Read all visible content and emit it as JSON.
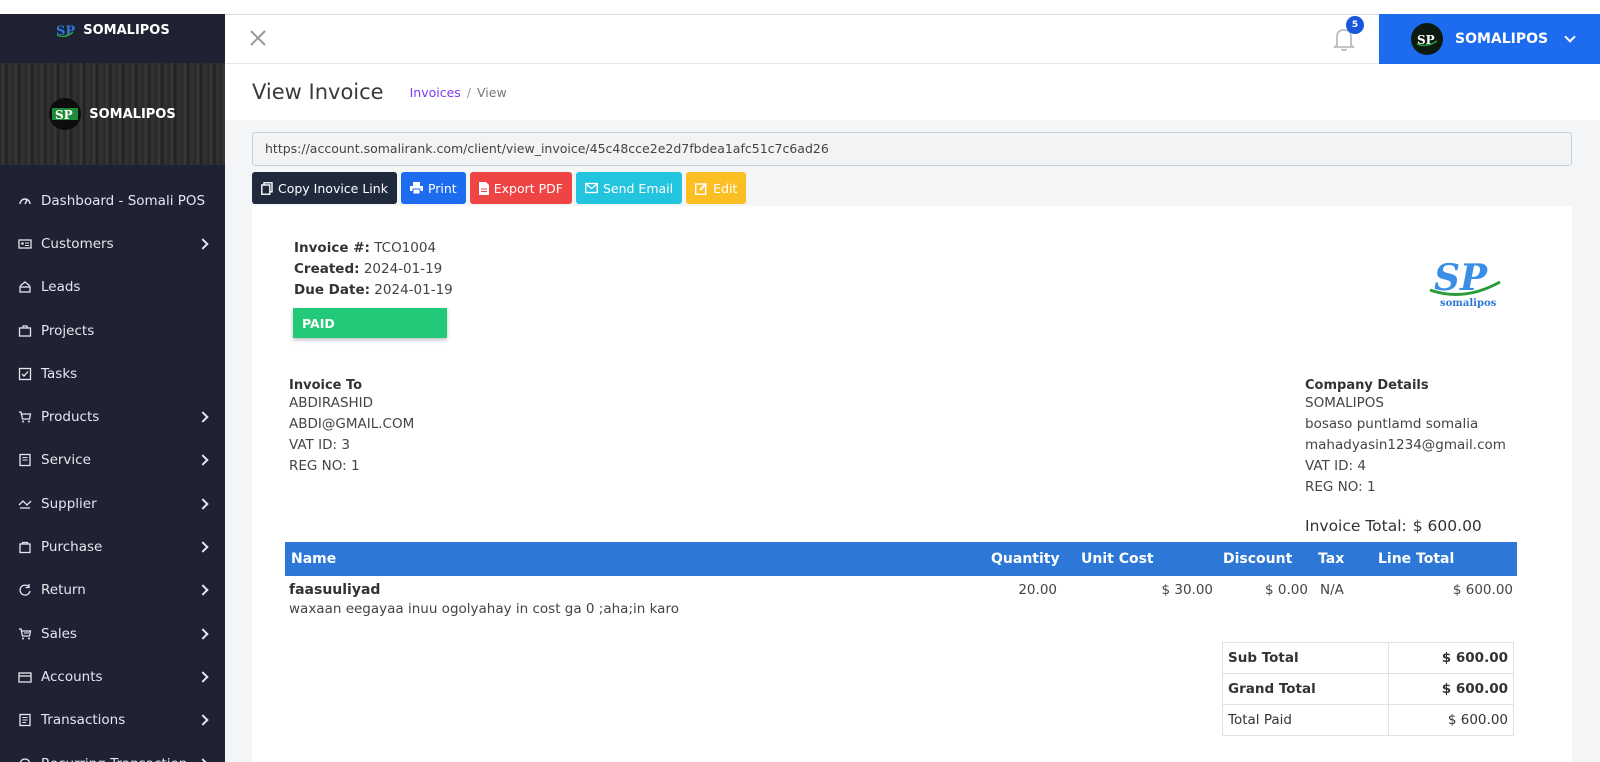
{
  "brand": {
    "name": "SOMALIPOS",
    "logo_text": "SP",
    "logo_subtext": "somalipos"
  },
  "sidebar": {
    "items": [
      {
        "label": "Dashboard - Somali POS",
        "icon": "dashboard-icon",
        "has_submenu": false
      },
      {
        "label": "Customers",
        "icon": "customers-icon",
        "has_submenu": true
      },
      {
        "label": "Leads",
        "icon": "leads-icon",
        "has_submenu": false
      },
      {
        "label": "Projects",
        "icon": "projects-icon",
        "has_submenu": false
      },
      {
        "label": "Tasks",
        "icon": "tasks-icon",
        "has_submenu": false
      },
      {
        "label": "Products",
        "icon": "products-icon",
        "has_submenu": true
      },
      {
        "label": "Service",
        "icon": "service-icon",
        "has_submenu": true
      },
      {
        "label": "Supplier",
        "icon": "supplier-icon",
        "has_submenu": true
      },
      {
        "label": "Purchase",
        "icon": "purchase-icon",
        "has_submenu": true
      },
      {
        "label": "Return",
        "icon": "return-icon",
        "has_submenu": true
      },
      {
        "label": "Sales",
        "icon": "sales-icon",
        "has_submenu": true
      },
      {
        "label": "Accounts",
        "icon": "accounts-icon",
        "has_submenu": true
      },
      {
        "label": "Transactions",
        "icon": "transactions-icon",
        "has_submenu": true
      },
      {
        "label": "Recurring Transaction",
        "icon": "recurring-icon",
        "has_submenu": true
      }
    ]
  },
  "topbar": {
    "notification_count": "5",
    "user_name": "SOMALIPOS"
  },
  "page": {
    "title": "View Invoice",
    "breadcrumb": {
      "parent": "Invoices",
      "current": "View"
    },
    "invoice_url": "https://account.somalirank.com/client/view_invoice/45c48cce2e2d7fbdea1afc51c7c6ad26"
  },
  "actions": {
    "copy_link": "Copy Inovice Link",
    "print": "Print",
    "export_pdf": "Export PDF",
    "send_email": "Send Email",
    "edit": "Edit"
  },
  "invoice": {
    "number_label": "Invoice #:",
    "number": "TCO1004",
    "created_label": "Created:",
    "created": "2024-01-19",
    "due_label": "Due Date:",
    "due": "2024-01-19",
    "status": "PAID",
    "to": {
      "heading": "Invoice To",
      "name": "ABDIRASHID",
      "email": "ABDI@GMAIL.COM",
      "vat": "VAT ID: 3",
      "reg": "REG NO: 1"
    },
    "company": {
      "heading": "Company Details",
      "name": "SOMALIPOS",
      "address": "bosaso puntlamd somalia",
      "email": "mahadyasin1234@gmail.com",
      "vat": "VAT ID: 4",
      "reg": "REG NO: 1"
    },
    "total_label": "Invoice Total:",
    "total": "$ 600.00",
    "columns": [
      "Name",
      "Quantity",
      "Unit Cost",
      "Discount",
      "Tax",
      "Line Total"
    ],
    "items": [
      {
        "name": "faasuuliyad",
        "description": "waxaan eegayaa inuu ogolyahay in cost ga 0 ;aha;in karo",
        "quantity": "20.00",
        "unit_cost": "$ 30.00",
        "discount": "$ 0.00",
        "tax": "N/A",
        "line_total": "$ 600.00"
      }
    ],
    "summary": {
      "sub_total_label": "Sub Total",
      "sub_total": "$ 600.00",
      "grand_total_label": "Grand Total",
      "grand_total": "$ 600.00",
      "total_paid_label": "Total Paid",
      "total_paid": "$ 600.00"
    }
  },
  "colors": {
    "sidebar_bg": "#1e2232",
    "accent_blue": "#1d6cf0",
    "table_header": "#2d78d7",
    "paid_green": "#22c979",
    "danger": "#ef4444",
    "info": "#22c4de",
    "warning": "#fbbf24"
  }
}
